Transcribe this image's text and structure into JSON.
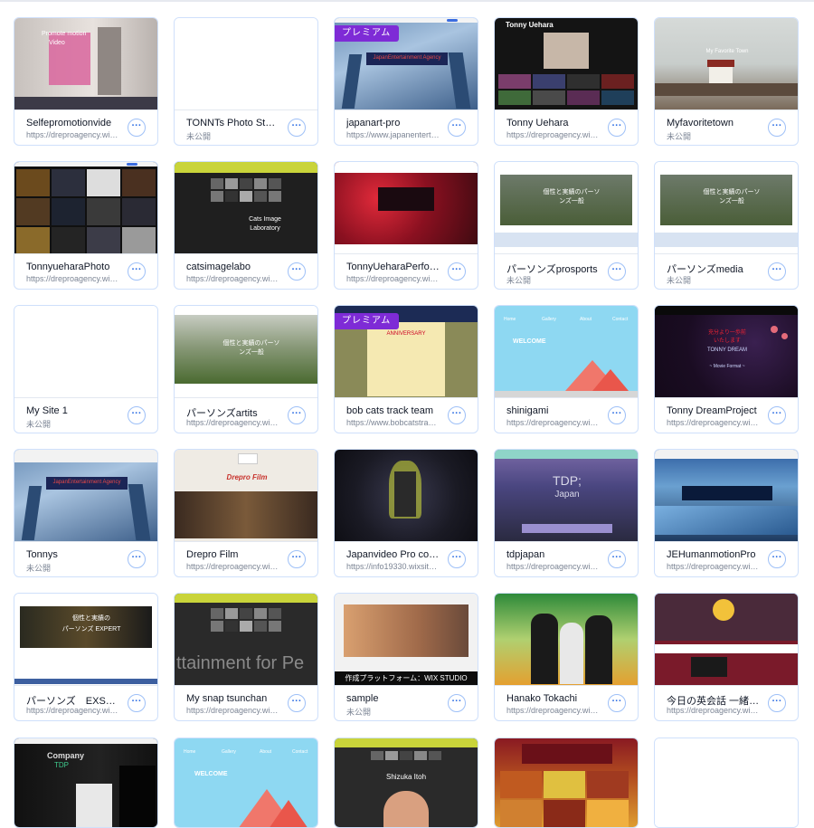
{
  "premium_label": "プレミアム",
  "more_glyph": "···",
  "sites": [
    {
      "name": "Selfepromotionvide",
      "url": "https://dreproagency.wixsite.com"
    },
    {
      "name": "TONNTs Photo Studio",
      "url": "未公開"
    },
    {
      "name": "japanart-pro",
      "url": "https://www.japanentertainment.com",
      "premium": true
    },
    {
      "name": "Tonny Uehara",
      "url": "https://dreproagency.wixsite.com"
    },
    {
      "name": "Myfavoritetown",
      "url": "未公開"
    },
    {
      "name": "TonnyueharaPhoto",
      "url": "https://dreproagency.wixsite.com"
    },
    {
      "name": "catsimagelabo",
      "url": "https://dreproagency.wixsite.com"
    },
    {
      "name": "TonnyUeharaPerformer",
      "url": "https://dreproagency.wixsite.com"
    },
    {
      "name": "パーソンズprosports",
      "url": "未公開"
    },
    {
      "name": "パーソンズmedia",
      "url": "未公開"
    },
    {
      "name": "My Site 1",
      "url": "未公開"
    },
    {
      "name": "パーソンズartits",
      "url": "https://dreproagency.wixsite.com"
    },
    {
      "name": "bob cats track team",
      "url": "https://www.bobcatstrackteam.com",
      "premium": true
    },
    {
      "name": "shinigami",
      "url": "https://dreproagency.wixsite.com"
    },
    {
      "name": "Tonny DreamProject",
      "url": "https://dreproagency.wixsite.com"
    },
    {
      "name": "Tonnys",
      "url": "未公開"
    },
    {
      "name": "Drepro Film",
      "url": "https://dreproagency.wixsite.com"
    },
    {
      "name": "Japanvideo Pro company",
      "url": "https://info19330.wixsite.com"
    },
    {
      "name": "tdpjapan",
      "url": "https://dreproagency.wixsite.com"
    },
    {
      "name": "JEHumanmotionPro",
      "url": "https://dreproagency.wixsite.com"
    },
    {
      "name": "パーソンズ　EXSPERT",
      "url": "https://dreproagency.wixsite.com"
    },
    {
      "name": "My snap tsunchan",
      "url": "https://dreproagency.wixsite.com"
    },
    {
      "name": "sample",
      "url": "未公開"
    },
    {
      "name": "Hanako Tokachi",
      "url": "https://dreproagency.wixsite.com"
    },
    {
      "name": "今日の英会話 一緒に学ぼう",
      "url": "https://dreproagency.wixsite.com"
    }
  ],
  "thumb_text": {
    "t1_line1": "Promote motion",
    "t1_line2": "Video",
    "japan_banner": "JapanEntertainment Agency",
    "tonny_header": "Tonny Uehara",
    "favorite_town": "My Favorite Town",
    "cats_line1": "Cats Image",
    "cats_line2": "Laboratory",
    "parsons_line1": "個性と実績のパーソ",
    "parsons_line2": "ンズ一般",
    "bobcats_anniv": "ANNIVERSARY",
    "bobcats_num": "6",
    "nav_home": "Home",
    "nav_gallery": "Gallery",
    "nav_about": "About",
    "nav_contact": "Contact",
    "welcome": "WELCOME",
    "dream_line1": "充分より一歩前",
    "dream_line2": "いたします",
    "dream_title": "TONNY DREAM",
    "dream_sub": "~ Movie Format ~",
    "drepro_title": "Drepro Film",
    "tdp_line1": "TDP;",
    "tdp_line2": "Japan",
    "expert_line1": "個性と実績の",
    "expert_line2": "パーソンズ EXPERT",
    "snap_text": "ttainment for Pe",
    "wix_studio": "作成プラットフォーム：WIX STUDIO",
    "company_line1": "Company",
    "company_line2": "TDP",
    "shizuka": "Shizuka Itoh"
  }
}
